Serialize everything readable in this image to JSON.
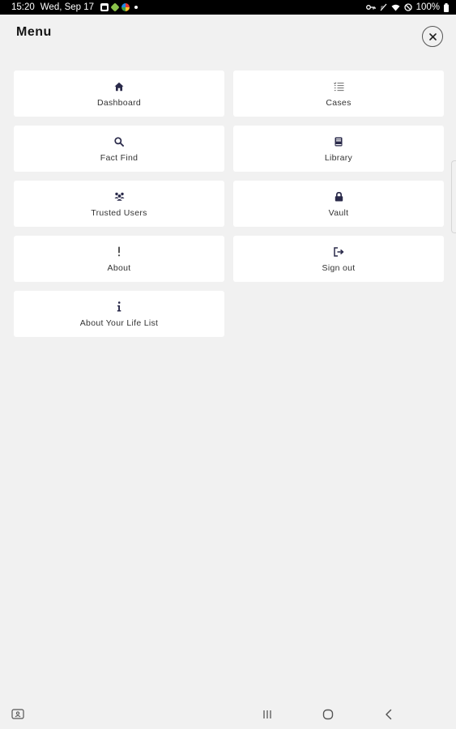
{
  "status_bar": {
    "time": "15:20",
    "date": "Wed, Sep 17",
    "battery": "100%"
  },
  "header": {
    "title": "Menu",
    "close_icon": "close-icon"
  },
  "menu_items": [
    {
      "label": "Dashboard",
      "icon": "home-icon"
    },
    {
      "label": "Cases",
      "icon": "checklist-icon"
    },
    {
      "label": "Fact Find",
      "icon": "search-icon"
    },
    {
      "label": "Library",
      "icon": "book-icon"
    },
    {
      "label": "Trusted Users",
      "icon": "users-icon"
    },
    {
      "label": "Vault",
      "icon": "lock-icon"
    },
    {
      "label": "About",
      "icon": "exclamation-icon"
    },
    {
      "label": "Sign out",
      "icon": "sign-out-icon"
    },
    {
      "label": "About Your Life List",
      "icon": "info-icon"
    }
  ],
  "colors": {
    "icon": "#2a2a4a",
    "background": "#f1f1f1",
    "card": "#ffffff"
  }
}
